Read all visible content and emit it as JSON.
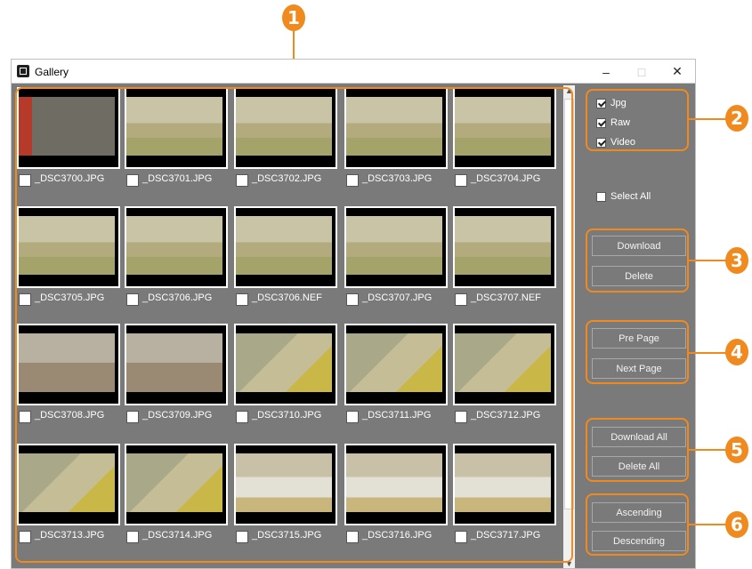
{
  "window": {
    "title": "Gallery",
    "controls": {
      "minimize": "–",
      "maximize": "□",
      "close": "✕"
    }
  },
  "annotations": [
    "1",
    "2",
    "3",
    "4",
    "5",
    "6"
  ],
  "gallery": {
    "items": [
      {
        "name": "_DSC3700.JPG",
        "scene": "room"
      },
      {
        "name": "_DSC3701.JPG",
        "scene": "shelf"
      },
      {
        "name": "_DSC3702.JPG",
        "scene": "shelf"
      },
      {
        "name": "_DSC3703.JPG",
        "scene": "shelf"
      },
      {
        "name": "_DSC3704.JPG",
        "scene": "shelf"
      },
      {
        "name": "_DSC3705.JPG",
        "scene": "shelf"
      },
      {
        "name": "_DSC3706.JPG",
        "scene": "shelf"
      },
      {
        "name": "_DSC3706.NEF",
        "scene": "shelf"
      },
      {
        "name": "_DSC3707.JPG",
        "scene": "shelf"
      },
      {
        "name": "_DSC3707.NEF",
        "scene": "shelf"
      },
      {
        "name": "_DSC3708.JPG",
        "scene": "floor"
      },
      {
        "name": "_DSC3709.JPG",
        "scene": "floor"
      },
      {
        "name": "_DSC3710.JPG",
        "scene": "blur"
      },
      {
        "name": "_DSC3711.JPG",
        "scene": "blur"
      },
      {
        "name": "_DSC3712.JPG",
        "scene": "blur"
      },
      {
        "name": "_DSC3713.JPG",
        "scene": "blur"
      },
      {
        "name": "_DSC3714.JPG",
        "scene": "blur"
      },
      {
        "name": "_DSC3715.JPG",
        "scene": "office"
      },
      {
        "name": "_DSC3716.JPG",
        "scene": "office"
      },
      {
        "name": "_DSC3717.JPG",
        "scene": "office"
      }
    ]
  },
  "filters": {
    "jpg": "Jpg",
    "raw": "Raw",
    "video": "Video"
  },
  "select_all": "Select All",
  "buttons": {
    "download": "Download",
    "delete": "Delete",
    "pre_page": "Pre Page",
    "next_page": "Next Page",
    "download_all": "Download All",
    "delete_all": "Delete All",
    "ascending": "Ascending",
    "descending": "Descending"
  },
  "colors": {
    "accent": "#f08a1e",
    "window_bg": "#7a7a7a"
  }
}
